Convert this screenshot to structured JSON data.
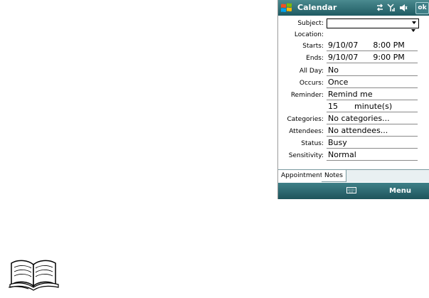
{
  "window": {
    "title": "Calendar",
    "ok_label": "ok"
  },
  "form": {
    "subject": {
      "label": "Subject:",
      "value": ""
    },
    "location": {
      "label": "Location:",
      "value": ""
    },
    "starts": {
      "label": "Starts:",
      "date": "9/10/07",
      "time": "8:00 PM"
    },
    "ends": {
      "label": "Ends:",
      "date": "9/10/07",
      "time": "9:00 PM"
    },
    "all_day": {
      "label": "All Day:",
      "value": "No"
    },
    "occurs": {
      "label": "Occurs:",
      "value": "Once"
    },
    "reminder": {
      "label": "Reminder:",
      "value": "Remind me",
      "amount": "15",
      "unit": "minute(s)"
    },
    "categories": {
      "label": "Categories:",
      "value": "No categories..."
    },
    "attendees": {
      "label": "Attendees:",
      "value": "No attendees..."
    },
    "status": {
      "label": "Status:",
      "value": "Busy"
    },
    "sensitivity": {
      "label": "Sensitivity:",
      "value": "Normal"
    }
  },
  "tabs": [
    {
      "label": "Appointment"
    },
    {
      "label": "Notes"
    }
  ],
  "menubar": {
    "menu_label": "Menu"
  },
  "icons": {
    "start": "windows-flag-icon",
    "connectivity": "connectivity-icon",
    "signal": "signal-icon",
    "volume": "volume-icon",
    "keyboard": "keyboard-icon",
    "note": "open-book-note-icon"
  },
  "colors": {
    "titlebar": "#2b6b73",
    "menubar": "#2b6b73",
    "tab_strip": "#e9f0f2"
  }
}
